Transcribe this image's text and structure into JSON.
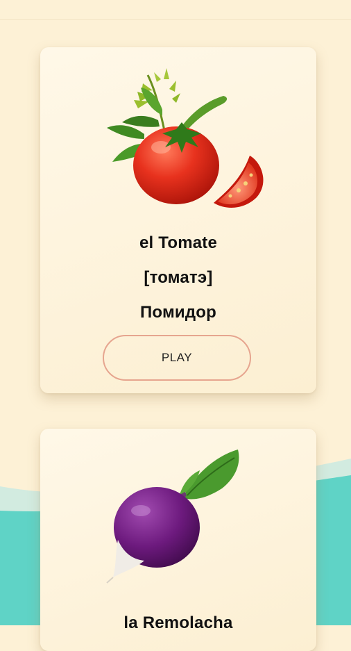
{
  "cards": [
    {
      "image_icon": "tomato-icon",
      "word": "el Tomate",
      "transcription": "[томатэ]",
      "translation": "Помидор",
      "play_label": "PLAY"
    },
    {
      "image_icon": "beetroot-icon",
      "word": "la Remolacha"
    }
  ],
  "colors": {
    "background": "#fdf1d6",
    "wave_teal": "#5fd3c6",
    "wave_light": "#cfe9df",
    "card": "#fff6e3",
    "play_border": "#e6a58f"
  }
}
